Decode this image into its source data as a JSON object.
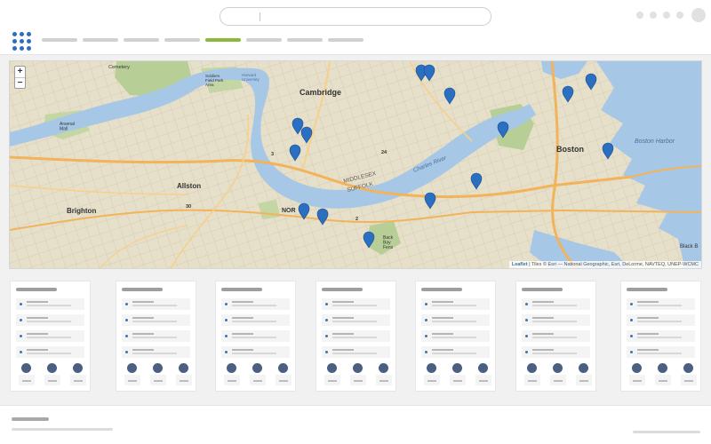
{
  "search": {
    "value": "",
    "placeholder": ""
  },
  "nav": {
    "items": 8,
    "active_index": 4
  },
  "map": {
    "zoom_in": "+",
    "zoom_out": "−",
    "labels": {
      "cambridge": "Cambridge",
      "boston": "Boston",
      "allston": "Allston",
      "brighton": "Brighton",
      "boston_harbor": "Boston Harbor",
      "charles_river": "Charles River",
      "middlesex": "MIDDLESEX",
      "suffolk": "SUFFOLK",
      "cemetery": "Cemetery",
      "arsenal_mall": "Arsenal\nMall",
      "soldiers_field": "Soldiers\nField Park\nArea",
      "harvard": "Harvard\nUniversity",
      "back_bay": "Back\nBay\nFens",
      "black_bay": "Black B",
      "route_2": "2",
      "route_3": "3",
      "route_24": "24",
      "route_30": "30",
      "nor": "NOR"
    },
    "attribution_link": "Leaflet",
    "attribution_text": " | Tiles © Esri — National Geographic, Esri, DeLorme, NAVTEQ, UNEP-WCMC"
  },
  "colors": {
    "accent": "#8cb83b",
    "brand": "#2d6dbd",
    "marker": "#2b6fc2",
    "water": "#a7c7e6",
    "land": "#e6dfc9",
    "park": "#b7cf96",
    "road": "#f2b35a"
  },
  "cards": {
    "count": 7,
    "rows_per_card": 4,
    "stats_per_card": 3
  },
  "icons": [
    "grid-icon",
    "map-marker-icon",
    "plus-icon",
    "minus-icon"
  ]
}
